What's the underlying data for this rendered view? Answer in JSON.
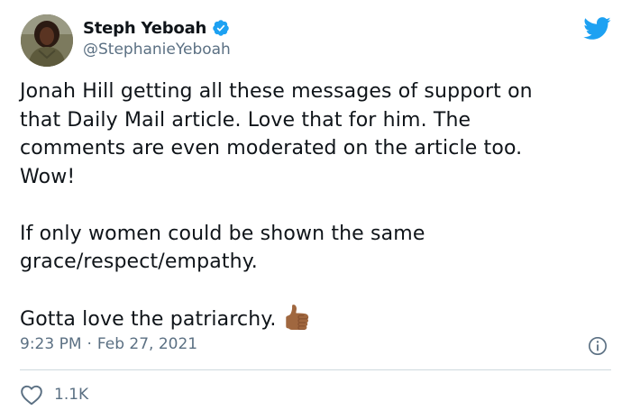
{
  "author": {
    "display_name": "Steph Yeboah",
    "handle": "@StephanieYeboah",
    "verified": true,
    "avatar": "profile-photo"
  },
  "brand_icon": "twitter-bird-icon",
  "colors": {
    "brand_blue": "#1da1f2",
    "text": "#0f1419",
    "secondary_text": "#5b7083",
    "divider": "#cfd9de"
  },
  "tweet": {
    "lines": [
      "Jonah Hill getting all these messages of support on",
      "that Daily Mail article. Love that for him. The",
      "comments are even moderated on the article too.",
      "Wow!",
      "If only women could be shown the same",
      "grace/respect/empathy.",
      "Gotta love the patriarchy."
    ],
    "trailing_emoji": "thumbs-up-icon"
  },
  "meta": {
    "time": "9:23 PM",
    "separator": "·",
    "date": "Feb 27, 2021"
  },
  "info_icon": "info-icon",
  "engagement": {
    "like_icon": "heart-outline-icon",
    "likes": "1.1K"
  }
}
